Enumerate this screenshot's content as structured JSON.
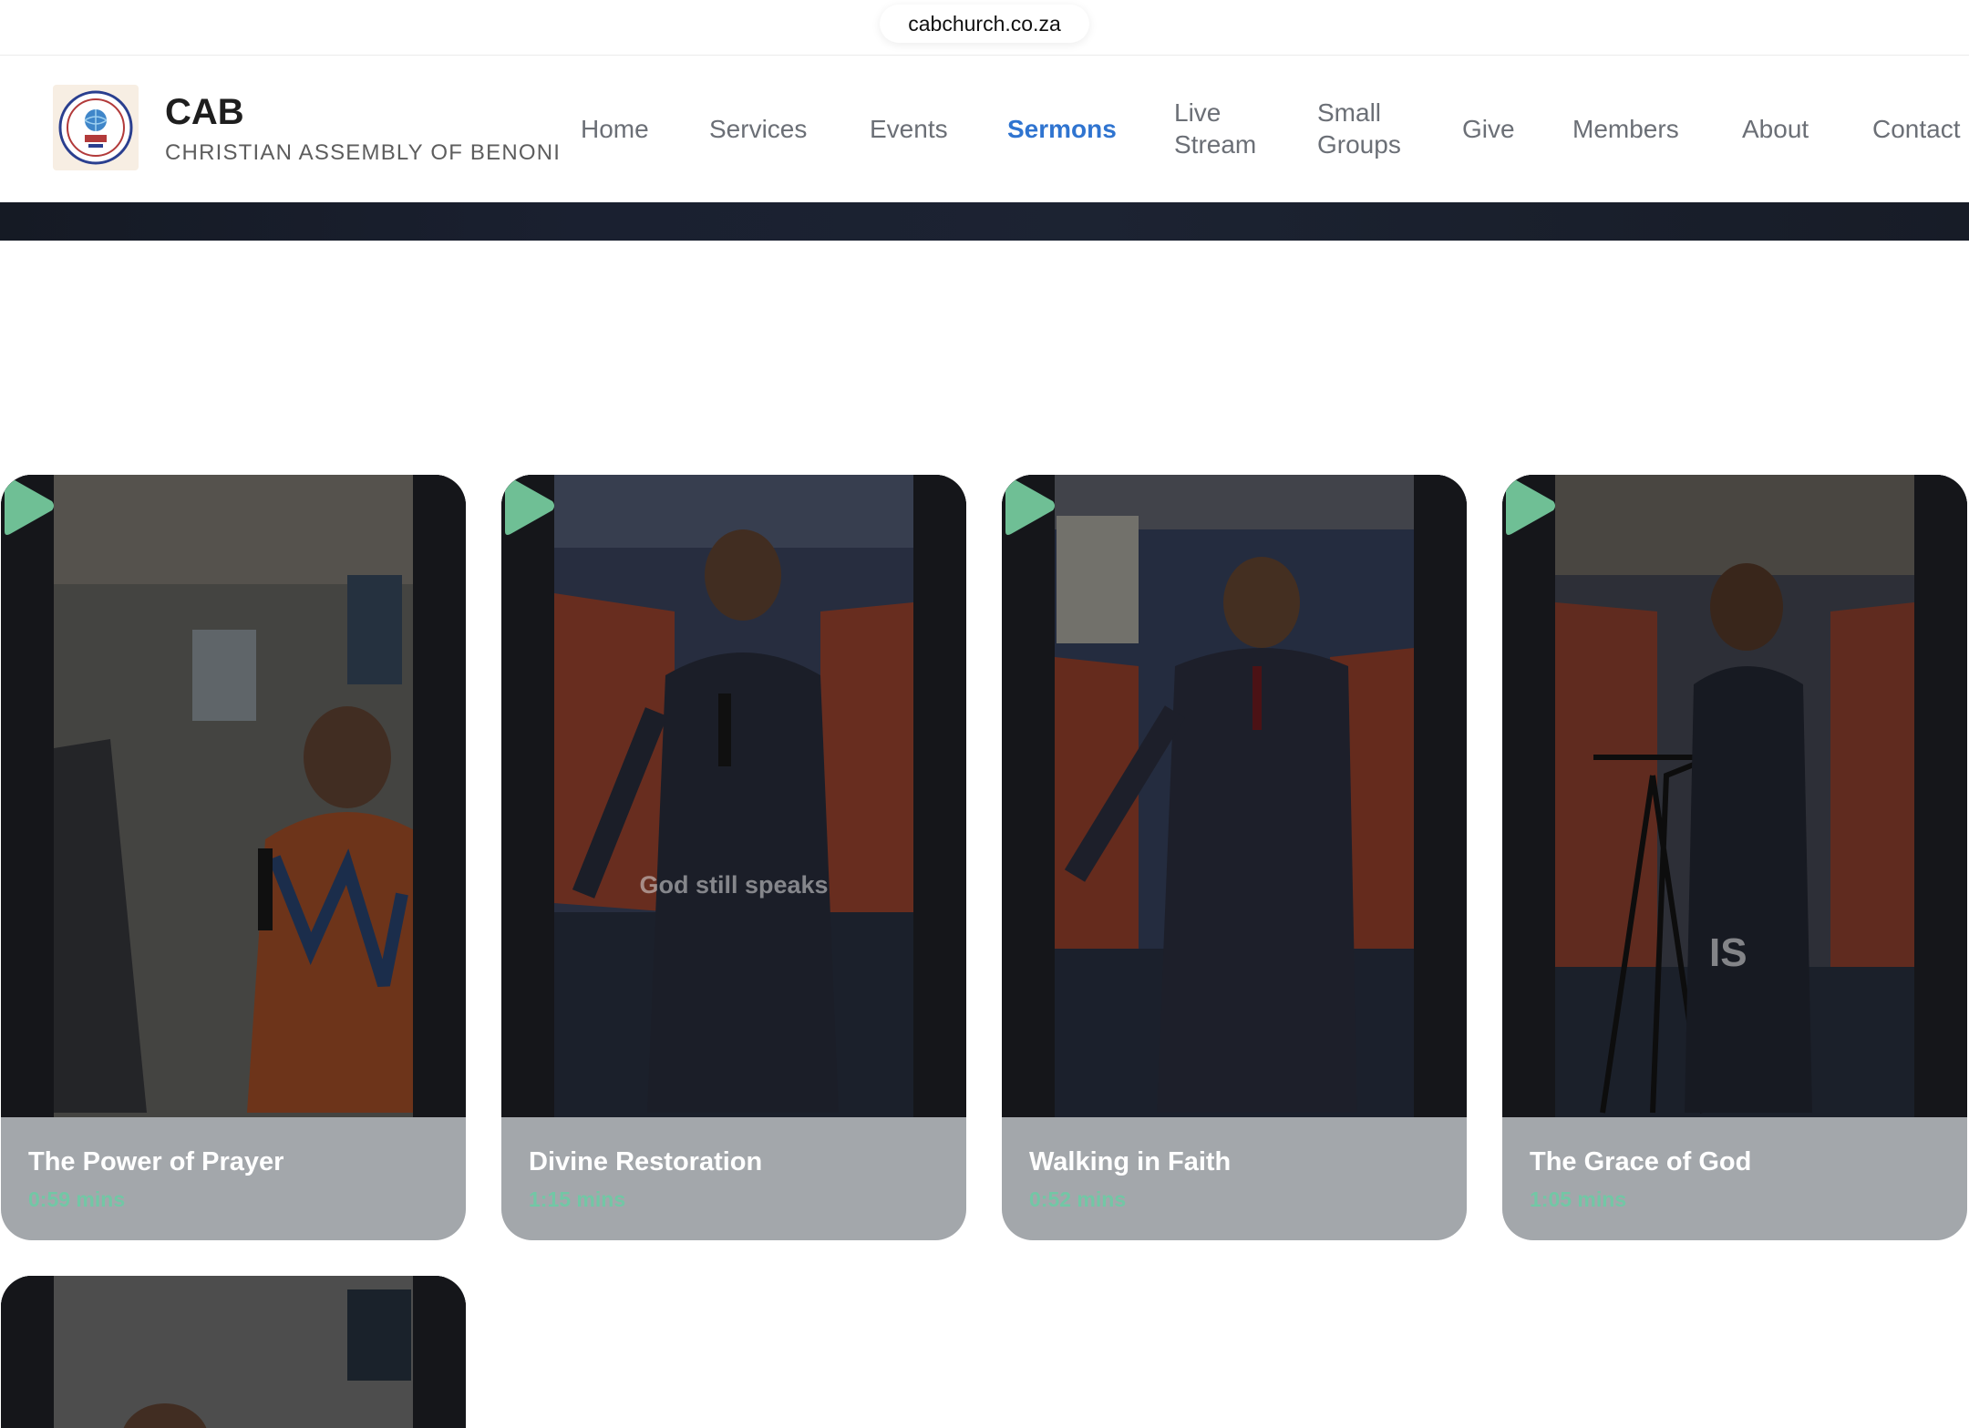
{
  "browser": {
    "url": "cabchurch.co.za"
  },
  "brand": {
    "title": "CAB",
    "subtitle": "CHRISTIAN ASSEMBLY OF BENONI"
  },
  "nav": {
    "home": "Home",
    "services": "Services",
    "events": "Events",
    "sermons": "Sermons",
    "live_stream_1": "Live",
    "live_stream_2": "Stream",
    "small_groups_1": "Small",
    "small_groups_2": "Groups",
    "give": "Give",
    "members": "Members",
    "about": "About",
    "contact": "Contact",
    "active": "Sermons"
  },
  "sermons": [
    {
      "title": "The Power of Prayer",
      "duration": "0:59 mins"
    },
    {
      "title": "Divine Restoration",
      "duration": "1:15 mins",
      "overlay": "God still speaks"
    },
    {
      "title": "Walking in Faith",
      "duration": "0:52 mins"
    },
    {
      "title": "The Grace of God",
      "duration": "1:05 mins",
      "overlay": "IS"
    }
  ],
  "colors": {
    "accent": "#2f74d0",
    "play_icon": "#6fbf95",
    "duration": "#72c7a5",
    "card_footer": "#a3a7ab"
  }
}
